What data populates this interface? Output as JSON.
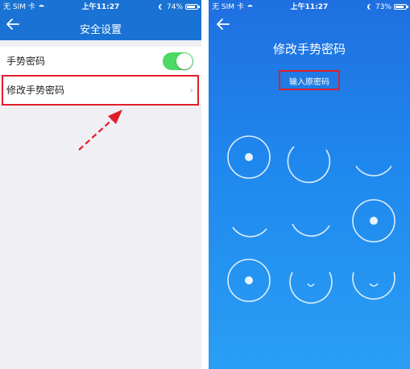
{
  "status_bar": {
    "carrier": "无 SIM 卡",
    "time": "上午11:27",
    "left_battery": "74%",
    "right_battery": "73%"
  },
  "left_screen": {
    "nav_title": "安全设置",
    "rows": [
      {
        "label": "手势密码",
        "toggle_on": true
      },
      {
        "label": "修改手势密码",
        "chevron": "›"
      }
    ]
  },
  "right_screen": {
    "title": "修改手势密码",
    "hint": "输入原密码"
  },
  "colors": {
    "nav_blue": "#1a73d4",
    "gesture_bg": "#1f88ee",
    "toggle_green": "#4cd964",
    "annotation_red": "#e01e2a"
  },
  "icons": [
    "back-arrow-icon",
    "wifi-icon",
    "moon-icon",
    "battery-icon",
    "chevron-right-icon",
    "annotation-arrow-icon"
  ]
}
